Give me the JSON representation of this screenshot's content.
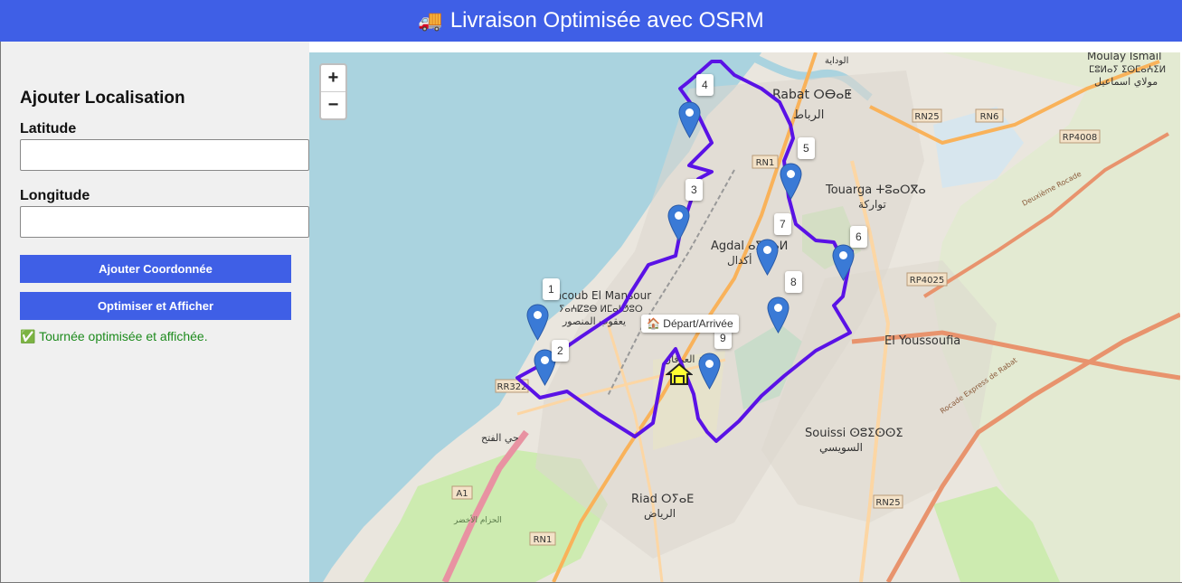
{
  "header": {
    "title": "Livraison Optimisée avec OSRM",
    "icon": "truck-icon"
  },
  "sidebar": {
    "heading": "Ajouter Localisation",
    "latitude_label": "Latitude",
    "latitude_value": "",
    "longitude_label": "Longitude",
    "longitude_value": "",
    "add_button": "Ajouter Coordonnée",
    "optimize_button": "Optimiser et Afficher",
    "status": "✅ Tournée optimisée et affichée."
  },
  "map": {
    "zoom_in": "+",
    "zoom_out": "−",
    "depot_tooltip": "🏠 Départ/Arrivée",
    "stops": [
      "1",
      "2",
      "3",
      "4",
      "5",
      "6",
      "7",
      "8",
      "9"
    ],
    "route_color": "#5a12e6",
    "marker_color": "#3a7ad6",
    "places": {
      "rabat": "Rabat ⵔⴱⴰⵟ",
      "rabat_ar": "الرباط",
      "touarga": "Touarga ⵜⵓⴰⵔⴳⴰ",
      "touarga_ar": "تواركة",
      "agdal": "Agdal ⴰⴳⴷⴰⵍ",
      "agdal_ar": "أكدال",
      "yacoub": "Yacoub El Mansour",
      "yacoub_tif": "ⵢⴰⵄⵇⵓⴱ ⵍⵎⴰⵏⵚⵓⵔ",
      "yacoub_ar": "يعقوب المنصور",
      "youssoufia": "El Youssoufia",
      "souissi": "Souissi ⵙⵓⵉⵙⵙⵉ",
      "souissi_ar": "السويسي",
      "riad": "Riad ⵔⵢⴰⴹ",
      "riad_ar": "الرياض",
      "fath_ar": "حي الفتح",
      "irfane_ar": "مدينة العرفان",
      "moulay": "Moulay Ismail",
      "moulay_tif": "ⵎⵓⵍⴰⵢ ⵉⵙⵎⴰⵄⵉⵍ",
      "moulay_ar": "مولاي اسماعيل",
      "oudaya_ar": "الوداية",
      "zaer_ar": "الحزام الأخضر"
    },
    "road_labels": {
      "rn25_a": "RN25",
      "rn6": "RN6",
      "rp4008": "RP4008",
      "rn1_a": "RN1",
      "rp4025": "RP4025",
      "rr322": "RR322",
      "a1": "A1",
      "rn1_b": "RN1",
      "rn25_b": "RN25",
      "rocade": "Deuxième Rocade",
      "rocade_express": "Rocade Express de Rabat"
    }
  }
}
